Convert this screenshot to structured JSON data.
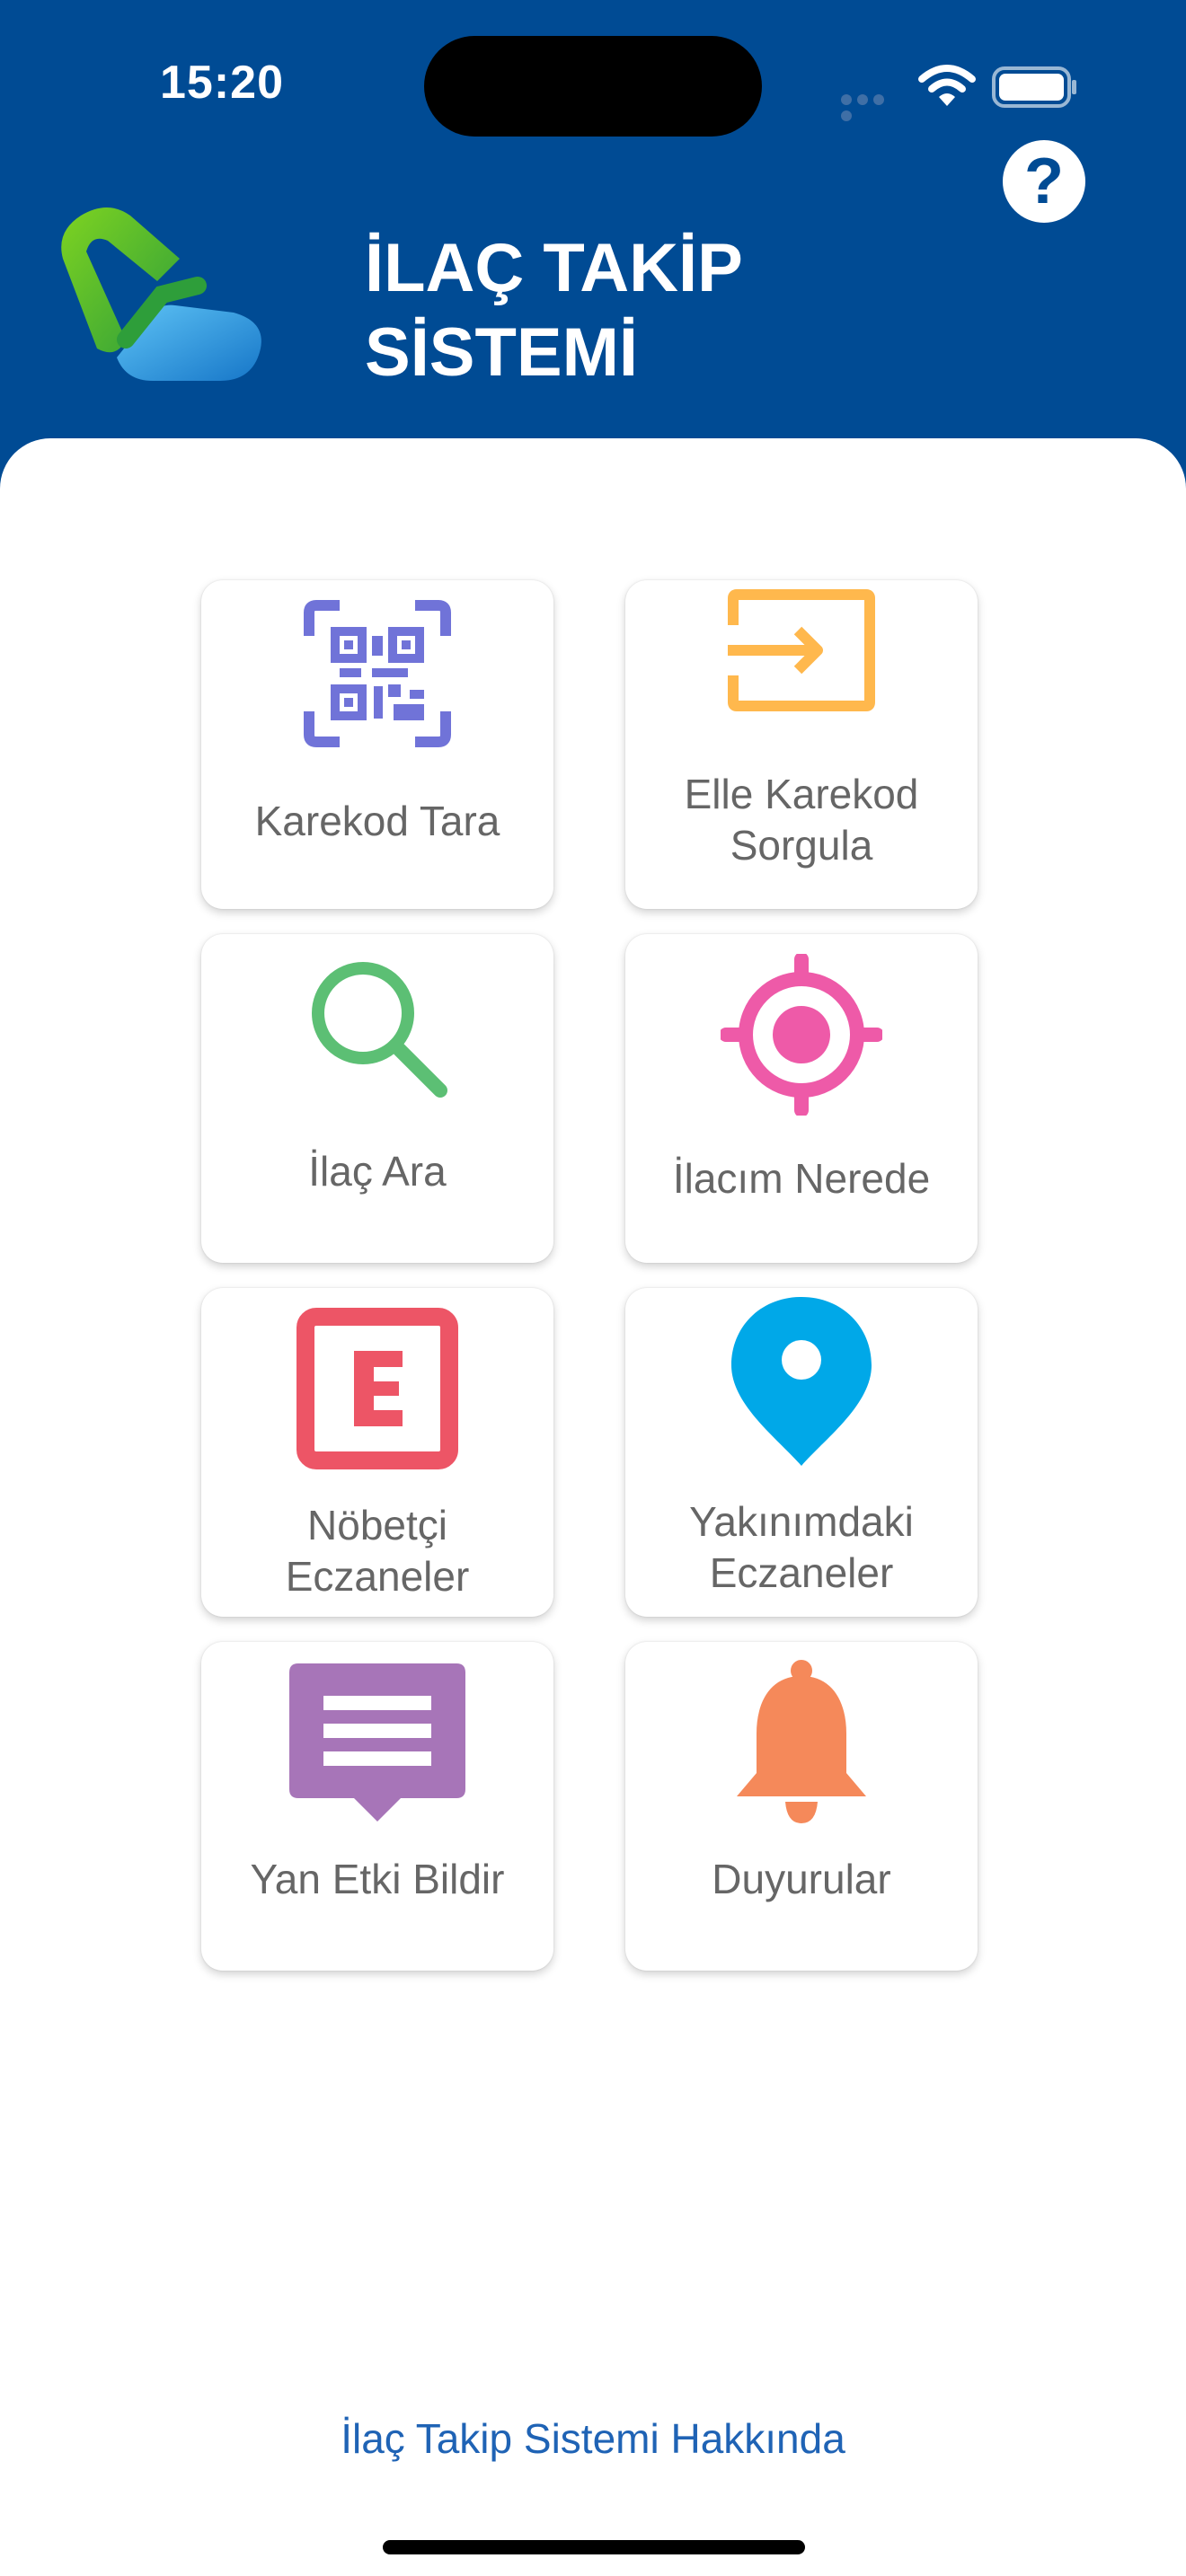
{
  "status_bar": {
    "time": "15:20"
  },
  "header": {
    "title_line1": "İLAÇ TAKİP",
    "title_line2": "SİSTEMİ",
    "help_label": "?"
  },
  "tiles": [
    {
      "label": "Karekod Tara",
      "icon": "qr-code-icon",
      "color": "#7073d8"
    },
    {
      "label": "Elle Karekod\nSorgula",
      "icon": "manual-entry-icon",
      "color": "#ffb84d"
    },
    {
      "label": "İlaç Ara",
      "icon": "search-icon",
      "color": "#5cbf74"
    },
    {
      "label": "İlacım Nerede",
      "icon": "location-target-icon",
      "color": "#ee5aa8"
    },
    {
      "label": "Nöbetçi\nEczaneler",
      "icon": "pharmacy-e-icon",
      "color": "#ed5566"
    },
    {
      "label": "Yakınımdaki\nEczaneler",
      "icon": "map-pin-icon",
      "color": "#00a8e8"
    },
    {
      "label": "Yan Etki Bildir",
      "icon": "message-icon",
      "color": "#a775b8"
    },
    {
      "label": "Duyurular",
      "icon": "bell-icon",
      "color": "#f5895a"
    }
  ],
  "footer": {
    "about_link": "İlaç Takip Sistemi Hakkında"
  },
  "colors": {
    "header_bg": "#004b94",
    "tile_label": "#666666",
    "link": "#1f63b5"
  }
}
